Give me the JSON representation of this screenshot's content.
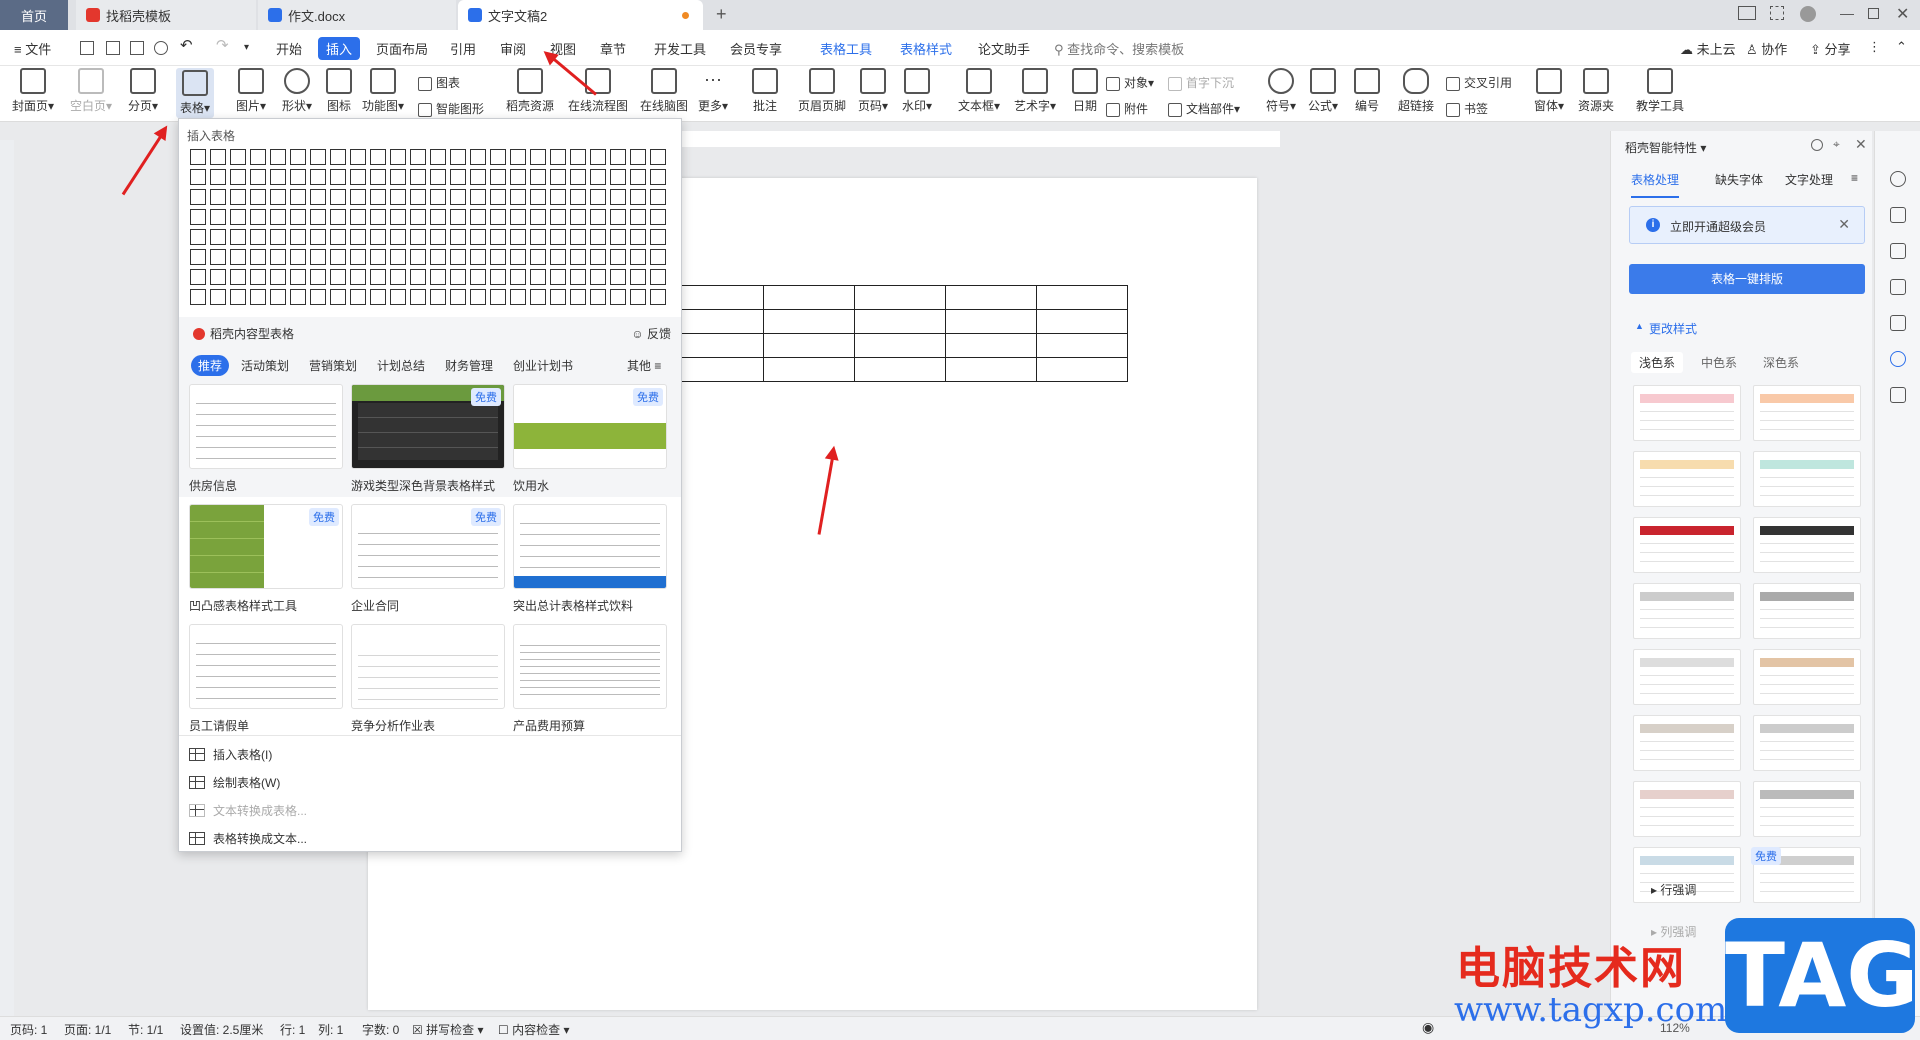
{
  "tabs": {
    "home": "首页",
    "t1": "找稻壳模板",
    "t2": "作文.docx",
    "t3": "文字文稿2"
  },
  "menu": {
    "file": "文件",
    "items": [
      "开始",
      "插入",
      "页面布局",
      "引用",
      "审阅",
      "视图",
      "章节",
      "开发工具",
      "会员专享"
    ],
    "tools": [
      "表格工具",
      "表格样式",
      "论文助手"
    ],
    "search": "查找命令、搜索模板",
    "cloud": "未上云",
    "collab": "协作",
    "share": "分享"
  },
  "ribbon": {
    "items": [
      "封面页",
      "空白页",
      "分页",
      "表格",
      "图片",
      "形状",
      "图标",
      "功能图",
      "稻壳资源",
      "在线流程图",
      "在线脑图",
      "更多",
      "批注",
      "页眉页脚",
      "页码",
      "水印",
      "文本框",
      "艺术字",
      "日期",
      "符号",
      "公式",
      "编号",
      "超链接",
      "窗体",
      "资源夹",
      "教学工具"
    ],
    "small": [
      "图表",
      "智能图形",
      "对象",
      "附件",
      "首字下沉",
      "文档部件",
      "交叉引用",
      "书签"
    ]
  },
  "dropdown": {
    "title": "插入表格",
    "sub": "稻壳内容型表格",
    "feedback": "反馈",
    "cats": [
      "推荐",
      "活动策划",
      "营销策划",
      "计划总结",
      "财务管理",
      "创业计划书"
    ],
    "more": "其他",
    "free": "免费",
    "templates": [
      "供房信息",
      "游戏类型深色背景表格样式",
      "饮用水",
      "凹凸感表格样式工具",
      "企业合同",
      "突出总计表格样式饮料",
      "员工请假单",
      "竞争分析作业表",
      "产品费用预算"
    ],
    "menu": [
      "插入表格(I)",
      "绘制表格(W)",
      "文本转换成表格...",
      "表格转换成文本..."
    ]
  },
  "panel": {
    "title": "稻壳智能特性",
    "tabs": [
      "表格处理",
      "缺失字体",
      "文字处理"
    ],
    "vip": "立即开通超级会员",
    "onekey": "表格一键排版",
    "change": "更改样式",
    "styletabs": [
      "浅色系",
      "中色系",
      "深色系"
    ],
    "free": "免费",
    "row": "行强调",
    "col": "列强调"
  },
  "status": {
    "page": "页码: 1",
    "pages": "页面: 1/1",
    "section": "节: 1/1",
    "setting": "设置值: 2.5厘米",
    "row": "行: 1",
    "col": "列: 1",
    "words": "字数: 0",
    "spell": "拼写检查",
    "content": "内容检查",
    "zoom": "112%"
  },
  "watermark": {
    "cn": "电脑技术网",
    "url": "www.tagxp.com",
    "tag": "TAG"
  },
  "colors": {
    "accent": "#2c6fea",
    "arrow": "#e02020"
  }
}
